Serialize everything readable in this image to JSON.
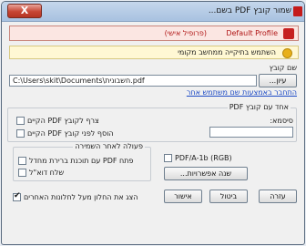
{
  "window": {
    "title": "שמור קובץ PDF בשם...",
    "close_label": "X"
  },
  "profile": {
    "name": "Default Profile",
    "tag": "(פרופיל אישי)"
  },
  "warning": {
    "text": "השתמש בתיקייה ממחשב מקומי"
  },
  "filename": {
    "label": "שם קובץ",
    "value": "C:\\Users\\skit\\Documents\\חשבונית.pdf",
    "browse_label": "עיון...",
    "link": "התחבר באמצעות שם משתמש אחר"
  },
  "merge": {
    "title": "אחד עם קובץ PDF",
    "append": "צרף לקובץ PDF הקיים",
    "prepend": "הוסף לפני קובץ PDF הקיים",
    "password_label": "סיסמא:"
  },
  "after_save": {
    "title": "פעולה לאחר השמירה",
    "open": "פתח PDF עם תוכנת ברירת מחדל",
    "email": "שלח דוא\"ל"
  },
  "pdfa": {
    "label": "PDF/A-1b (RGB)",
    "options_button": "שנה אפשרויות..."
  },
  "footer": {
    "keep_on_top": "הצג את החלון מעל לחלונות האחרים",
    "keep_on_top_checked": true,
    "help": "עזרה",
    "cancel": "ביטול",
    "ok": "אישור"
  }
}
